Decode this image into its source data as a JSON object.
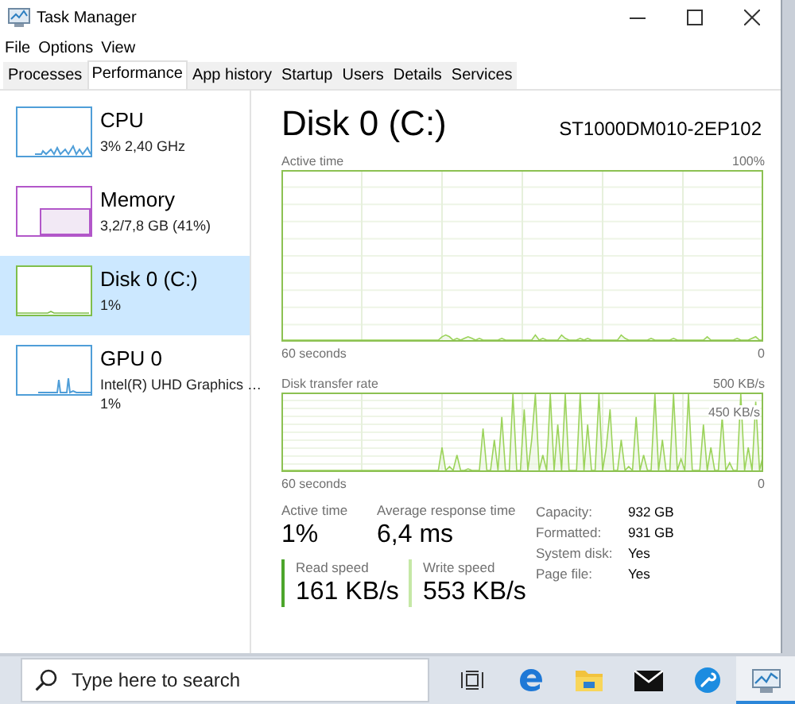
{
  "window": {
    "title": "Task Manager"
  },
  "menu": [
    "File",
    "Options",
    "View"
  ],
  "tabs": [
    {
      "label": "Processes",
      "selected": false
    },
    {
      "label": "Performance",
      "selected": true
    },
    {
      "label": "App history",
      "selected": false
    },
    {
      "label": "Startup",
      "selected": false
    },
    {
      "label": "Users",
      "selected": false
    },
    {
      "label": "Details",
      "selected": false
    },
    {
      "label": "Services",
      "selected": false
    }
  ],
  "sidebar": {
    "items": [
      {
        "kind": "cpu",
        "name": "CPU",
        "details": [
          "3% 2,40 GHz"
        ],
        "selected": false
      },
      {
        "kind": "memory",
        "name": "Memory",
        "details": [
          "3,2/7,8 GB (41%)"
        ],
        "selected": false
      },
      {
        "kind": "disk",
        "name": "Disk 0 (C:)",
        "details": [
          "1%"
        ],
        "selected": true
      },
      {
        "kind": "gpu",
        "name": "GPU 0",
        "details": [
          "Intel(R) UHD Graphics …",
          "1%"
        ],
        "selected": false
      }
    ]
  },
  "detail": {
    "title": "Disk 0 (C:)",
    "model": "ST1000DM010-2EP102",
    "graphs": [
      {
        "kind": "active",
        "label": "Active time",
        "max": "100%",
        "time": "60 seconds",
        "min": "0"
      },
      {
        "kind": "transfer",
        "label": "Disk transfer rate",
        "max": "500 KB/s",
        "marker": "450 KB/s",
        "time": "60 seconds",
        "min": "0"
      }
    ],
    "stats": [
      {
        "label": "Active time",
        "value": "1%"
      },
      {
        "label": "Average response time",
        "value": "6,4 ms"
      }
    ],
    "speeds": [
      {
        "kind": "read",
        "label": "Read speed",
        "value": "161 KB/s"
      },
      {
        "kind": "write",
        "label": "Write speed",
        "value": "553 KB/s"
      }
    ],
    "properties": [
      {
        "label": "Capacity:",
        "value": "932 GB"
      },
      {
        "label": "Formatted:",
        "value": "931 GB"
      },
      {
        "label": "System disk:",
        "value": "Yes"
      },
      {
        "label": "Page file:",
        "value": "Yes"
      }
    ]
  },
  "taskbar": {
    "search": {
      "placeholder": "Type here to search"
    },
    "apps": [
      {
        "kind": "task-view",
        "active": false
      },
      {
        "kind": "edge",
        "active": false
      },
      {
        "kind": "folder",
        "active": false
      },
      {
        "kind": "mail",
        "active": false
      },
      {
        "kind": "wrench",
        "active": false
      },
      {
        "kind": "task-manager",
        "active": true
      }
    ]
  }
}
